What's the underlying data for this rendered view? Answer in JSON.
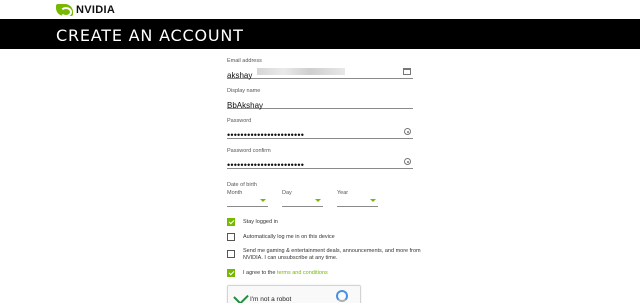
{
  "brand": {
    "name": "NVIDIA",
    "accent_color": "#76b900"
  },
  "page": {
    "title": "CREATE AN ACCOUNT"
  },
  "form": {
    "email": {
      "label": "Email address",
      "value": "akshay"
    },
    "display_name": {
      "label": "Display name",
      "value": "BbAkshay"
    },
    "password": {
      "label": "Password",
      "value": "•••••••••••••••••••••••"
    },
    "password_confirm": {
      "label": "Password confirm",
      "value": "•••••••••••••••••••••••"
    },
    "dob": {
      "label": "Date of birth",
      "month": "Month",
      "day": "Day",
      "year": "Year"
    },
    "checkboxes": {
      "stay_logged_in": {
        "label": "Stay logged in",
        "checked": true
      },
      "auto_login": {
        "label": "Automatically log me in on this device",
        "checked": false
      },
      "marketing": {
        "label": "Send me gaming & entertainment deals, announcements, and more from NVIDIA. I can unsubscribe at any time.",
        "checked": false
      },
      "terms": {
        "label": "I agree to the ",
        "link": "terms and conditions",
        "checked": true
      }
    },
    "recaptcha": {
      "label": "I'm not a robot"
    }
  }
}
